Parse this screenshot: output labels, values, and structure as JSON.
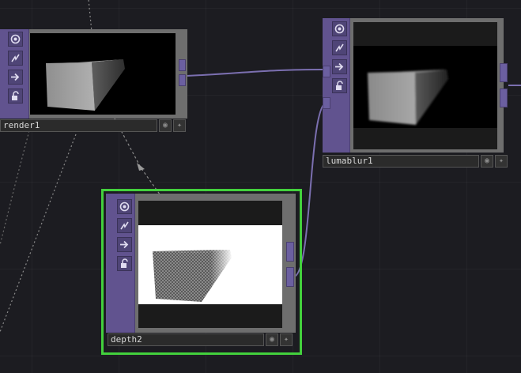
{
  "nodes": {
    "render": {
      "name": "render1"
    },
    "lumablur": {
      "name": "lumablur1"
    },
    "depth": {
      "name": "depth2"
    }
  },
  "colors": {
    "background": "#1c1c21",
    "node_strip": "#61538f",
    "wire": "#7b6fb0",
    "selection": "#43d13d"
  },
  "icons": [
    "viewer-toggle-icon",
    "bypass-icon",
    "export-arrow-icon",
    "lock-icon",
    "display-flag-icon",
    "render-flag-icon"
  ]
}
